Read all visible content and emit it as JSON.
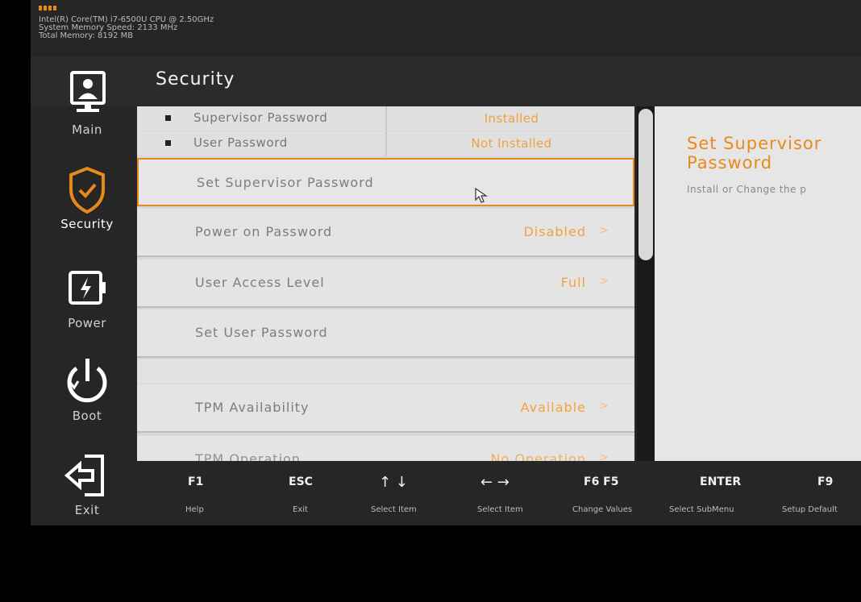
{
  "sysinfo": {
    "cpu": "Intel(R) Core(TM) i7-6500U CPU @ 2.50GHz",
    "memory_speed": "System Memory Speed: 2133 MHz",
    "total_memory": "Total Memory: 8192 MB"
  },
  "sidebar": {
    "items": [
      {
        "label": "Main",
        "icon": "monitor-user-icon"
      },
      {
        "label": "Security",
        "icon": "shield-check-icon",
        "active": true
      },
      {
        "label": "Power",
        "icon": "battery-bolt-icon"
      },
      {
        "label": "Boot",
        "icon": "power-icon"
      },
      {
        "label": "Exit",
        "icon": "exit-arrow-icon"
      }
    ]
  },
  "section_title": "Security",
  "status": [
    {
      "name": "Supervisor Password",
      "value": "Installed"
    },
    {
      "name": "User Password",
      "value": "Not Installed"
    }
  ],
  "items": [
    {
      "name": "Set Supervisor Password",
      "value": "",
      "selected": true
    },
    {
      "name": "Power on Password",
      "value": "Disabled"
    },
    {
      "name": "User Access Level",
      "value": "Full"
    },
    {
      "name": "Set User Password",
      "value": ""
    },
    {
      "name": "TPM Availability",
      "value": "Available"
    },
    {
      "name": "TPM Operation",
      "value": "No Operation"
    }
  ],
  "help": {
    "title": "Set Supervisor\nPassword",
    "description": "Install or Change the p"
  },
  "footer": {
    "keys": [
      {
        "key": "F1",
        "label": "Help"
      },
      {
        "key": "ESC",
        "label": "Exit"
      },
      {
        "key": "↑ ↓",
        "label": "Select Item"
      },
      {
        "key": "← →",
        "label": "Select Item"
      },
      {
        "key": "F6 F5",
        "label": "Change Values"
      },
      {
        "key": "ENTER",
        "label": "Select SubMenu"
      },
      {
        "key": "F9",
        "label": "Setup Default"
      }
    ]
  },
  "colors": {
    "accent": "#e88a1a",
    "value_orange": "#f2a33c",
    "screen_bg": "#262626",
    "list_bg": "#e4e4e4"
  }
}
